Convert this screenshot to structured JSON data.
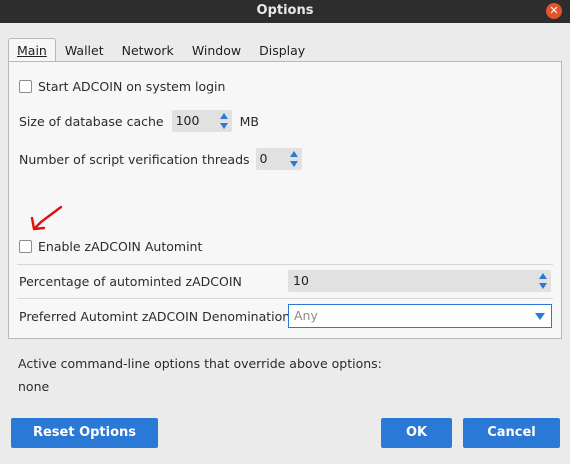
{
  "window": {
    "title": "Options"
  },
  "tabs": [
    {
      "label": "Main"
    },
    {
      "label": "Wallet"
    },
    {
      "label": "Network"
    },
    {
      "label": "Window"
    },
    {
      "label": "Display"
    }
  ],
  "main": {
    "start_on_login": {
      "label": "Start ADCOIN on system login",
      "checked": false
    },
    "db_cache": {
      "label": "Size of database cache",
      "value": "100",
      "unit": "MB"
    },
    "script_threads": {
      "label": "Number of script verification threads",
      "value": "0"
    },
    "automint": {
      "label": "Enable zADCOIN Automint",
      "checked": false
    },
    "automint_percentage": {
      "label": "Percentage of autominted zADCOIN",
      "value": "10"
    },
    "automint_denomination": {
      "label": "Preferred Automint zADCOIN Denomination",
      "value": "Any"
    }
  },
  "override": {
    "heading": "Active command-line options that override above options:",
    "value": "none"
  },
  "buttons": {
    "reset": "Reset Options",
    "ok": "OK",
    "cancel": "Cancel"
  },
  "colors": {
    "accent": "#2a79d6",
    "annotation_arrow": "#e01010"
  }
}
